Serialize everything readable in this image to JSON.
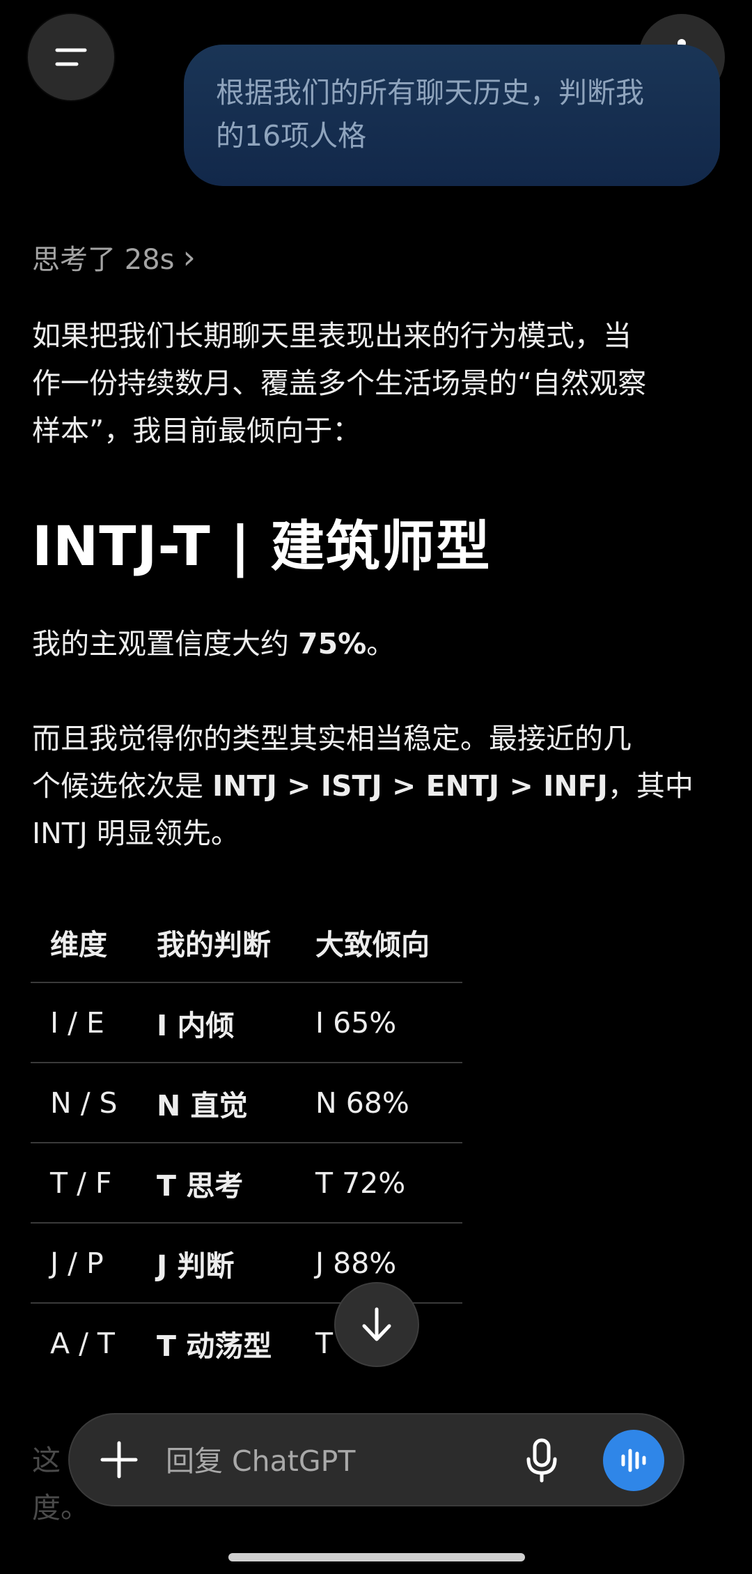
{
  "header": {
    "menu_icon": "hamburger-menu-icon",
    "more_icon": "vertical-dots-icon"
  },
  "user_message": {
    "line1": "根据我们的所有聊天历史，判断我",
    "line2": "的16项人格",
    "bubble_color": "#163052"
  },
  "thought": {
    "label": "思考了 28s",
    "chevron": "›"
  },
  "response": {
    "intro_line1": "如果把我们长期聊天里表现出来的行为模式，当",
    "intro_line2": "作一份持续数月、覆盖多个生活场景的“自然观察",
    "intro_line3": "样本”，我目前最倾向于：",
    "heading": "INTJ-T | 建筑师型",
    "confidence_prefix": "我的主观置信度大约 ",
    "confidence_value": "75%",
    "confidence_suffix": "。",
    "candidates_line1": "而且我觉得你的类型其实相当稳定。最接近的几",
    "candidates_line2_prefix": "个候选依次是 ",
    "candidates_list": "INTJ > ISTJ > ENTJ > INFJ",
    "candidates_line2_suffix": "，其中",
    "candidates_line3": "INTJ 明显领先。",
    "table": {
      "headers": [
        "维度",
        "我的判断",
        "大致倾向"
      ],
      "rows": [
        {
          "dimension": "I / E",
          "judgment": "I 内倾",
          "tendency": "I 65%"
        },
        {
          "dimension": "N / S",
          "judgment": "N 直觉",
          "tendency": "N 68%"
        },
        {
          "dimension": "T / F",
          "judgment": "T 思考",
          "tendency": "T 72%"
        },
        {
          "dimension": "J / P",
          "judgment": "J 判断",
          "tendency": "J 88%"
        },
        {
          "dimension": "A / T",
          "judgment": "T 动荡型",
          "tendency": "T"
        }
      ]
    },
    "trailing_line1": "这",
    "trailing_line2": "度。"
  },
  "scroll_down_icon": "arrow-down-icon",
  "composer": {
    "placeholder": "回复 ChatGPT",
    "plus_icon": "plus-icon",
    "mic_icon": "microphone-icon",
    "voice_icon": "voice-waveform-icon",
    "voice_color": "#2f86e8"
  }
}
